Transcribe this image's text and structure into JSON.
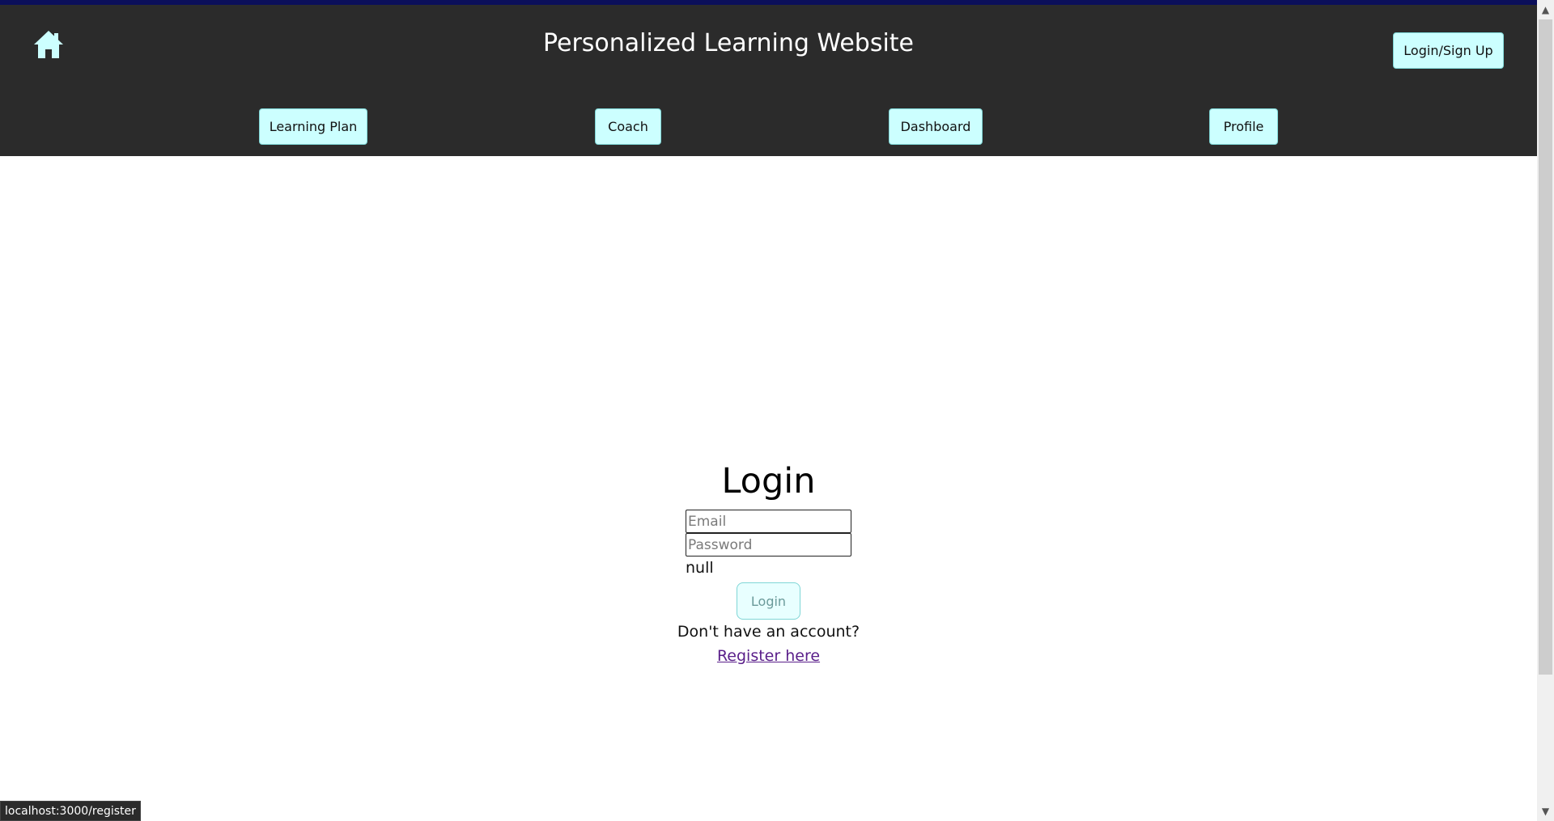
{
  "header": {
    "title": "Personalized Learning Website",
    "login_signup_label": "Login/Sign Up",
    "home_icon": "home-icon"
  },
  "nav": {
    "items": [
      {
        "label": "Learning Plan"
      },
      {
        "label": "Coach"
      },
      {
        "label": "Dashboard"
      },
      {
        "label": "Profile"
      }
    ]
  },
  "login": {
    "title": "Login",
    "email_placeholder": "Email",
    "password_placeholder": "Password",
    "error_text": "null",
    "submit_label": "Login",
    "no_account_text": "Don't have an account?",
    "register_link_label": "Register here"
  },
  "status_bar": {
    "url": "localhost:3000/register"
  },
  "colors": {
    "header_bg": "#2b2b2b",
    "button_bg": "#ccffff",
    "home_icon": "#ccffff",
    "link": "#5a1f8a"
  }
}
